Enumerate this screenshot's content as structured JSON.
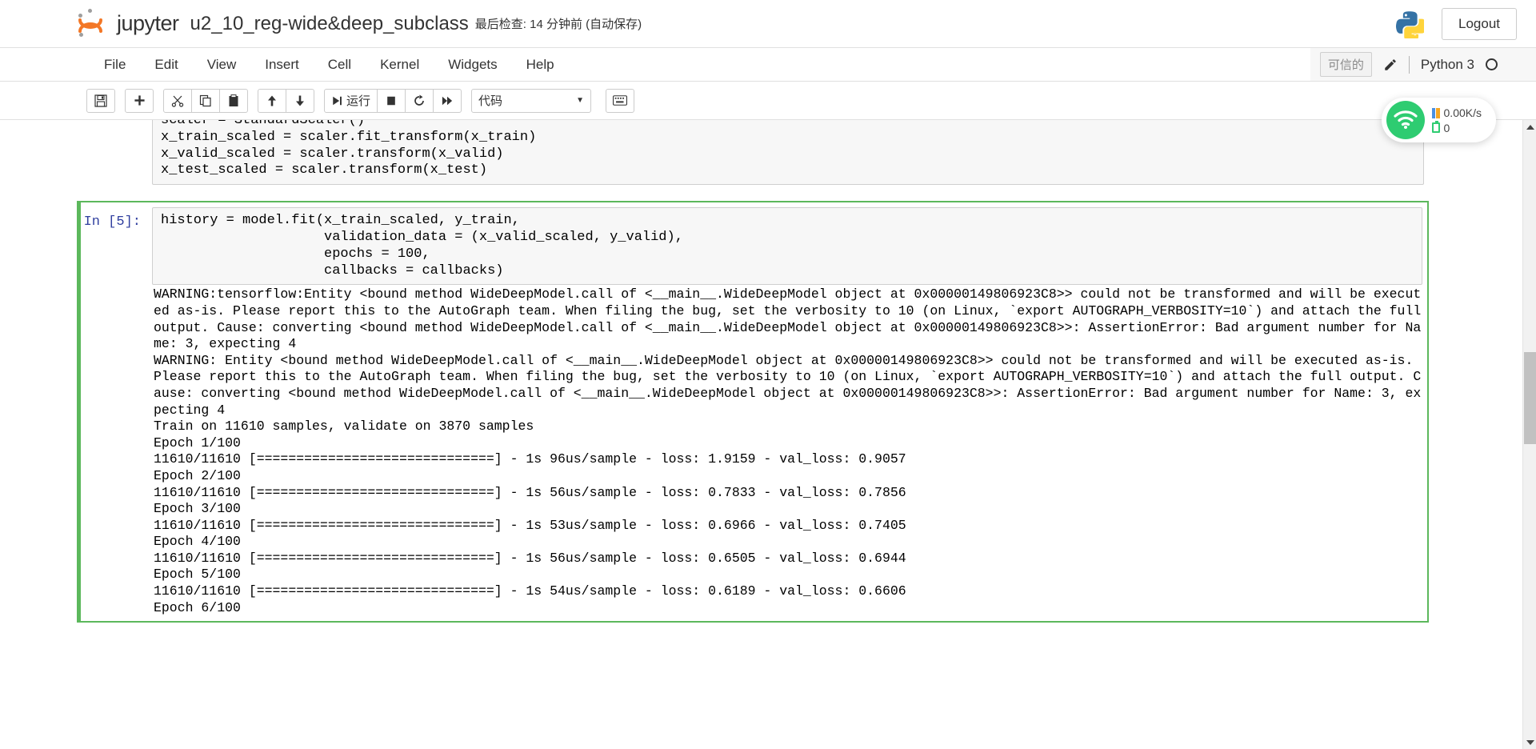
{
  "header": {
    "brand": "jupyter",
    "notebook_name": "u2_10_reg-wide&deep_subclass",
    "checkpoint": "最后检查: 14 分钟前  (自动保存)",
    "logout_label": "Logout",
    "python_logo_icon": "python-logo-icon"
  },
  "menubar": {
    "items": [
      {
        "label": "File"
      },
      {
        "label": "Edit"
      },
      {
        "label": "View"
      },
      {
        "label": "Insert"
      },
      {
        "label": "Cell"
      },
      {
        "label": "Kernel"
      },
      {
        "label": "Widgets"
      },
      {
        "label": "Help"
      }
    ],
    "trusted_label": "可信的",
    "edit_icon": "pencil-icon",
    "kernel_name": "Python 3",
    "kernel_status_icon": "kernel-idle-circle-icon"
  },
  "toolbar": {
    "groups": [
      {
        "buttons": [
          {
            "name": "save-button",
            "icon": "floppy-disk-icon",
            "glyph": "💾"
          }
        ]
      },
      {
        "buttons": [
          {
            "name": "insert-cell-below-button",
            "icon": "plus-icon",
            "glyph": "+"
          }
        ]
      },
      {
        "buttons": [
          {
            "name": "cut-cell-button",
            "icon": "scissors-icon",
            "glyph": "✂"
          },
          {
            "name": "copy-cell-button",
            "icon": "copy-icon",
            "glyph": "⧉"
          },
          {
            "name": "paste-cell-button",
            "icon": "paste-icon",
            "glyph": "📋"
          }
        ]
      },
      {
        "buttons": [
          {
            "name": "move-cell-up-button",
            "icon": "arrow-up-icon",
            "glyph": "↑"
          },
          {
            "name": "move-cell-down-button",
            "icon": "arrow-down-icon",
            "glyph": "↓"
          }
        ]
      },
      {
        "buttons": [
          {
            "name": "run-cell-button",
            "icon": "run-icon",
            "glyph": "⏭",
            "label": "运行"
          },
          {
            "name": "interrupt-kernel-button",
            "icon": "stop-square-icon",
            "glyph": "■"
          },
          {
            "name": "restart-kernel-button",
            "icon": "restart-icon",
            "glyph": "↻"
          },
          {
            "name": "restart-and-run-all-button",
            "icon": "fast-forward-icon",
            "glyph": "»"
          }
        ]
      }
    ],
    "cell_type_value": "代码",
    "cell_type_caret": "▼",
    "command_palette_icon": "keyboard-icon",
    "command_palette_glyph": "⌨"
  },
  "notebook": {
    "cells": [
      {
        "name": "code-cell-scaler",
        "prompt": "",
        "selected": false,
        "code_lines": [
          "scaler = StandardScaler()",
          "x_train_scaled = scaler.fit_transform(x_train)",
          "x_valid_scaled = scaler.transform(x_valid)",
          "x_test_scaled = scaler.transform(x_test)"
        ]
      },
      {
        "name": "code-cell-model-fit",
        "prompt": "In [5]:",
        "selected": true,
        "code_lines": [
          "history = model.fit(x_train_scaled, y_train,",
          "                    validation_data = (x_valid_scaled, y_valid),",
          "                    epochs = 100,",
          "                    callbacks = callbacks)"
        ]
      }
    ],
    "output": "WARNING:tensorflow:Entity <bound method WideDeepModel.call of <__main__.WideDeepModel object at 0x00000149806923C8>> could not be transformed and will be executed as-is. Please report this to the AutoGraph team. When filing the bug, set the verbosity to 10 (on Linux, `export AUTOGRAPH_VERBOSITY=10`) and attach the full output. Cause: converting <bound method WideDeepModel.call of <__main__.WideDeepModel object at 0x00000149806923C8>>: AssertionError: Bad argument number for Name: 3, expecting 4\nWARNING: Entity <bound method WideDeepModel.call of <__main__.WideDeepModel object at 0x00000149806923C8>> could not be transformed and will be executed as-is. Please report this to the AutoGraph team. When filing the bug, set the verbosity to 10 (on Linux, `export AUTOGRAPH_VERBOSITY=10`) and attach the full output. Cause: converting <bound method WideDeepModel.call of <__main__.WideDeepModel object at 0x00000149806923C8>>: AssertionError: Bad argument number for Name: 3, expecting 4\nTrain on 11610 samples, validate on 3870 samples\nEpoch 1/100\n11610/11610 [==============================] - 1s 96us/sample - loss: 1.9159 - val_loss: 0.9057\nEpoch 2/100\n11610/11610 [==============================] - 1s 56us/sample - loss: 0.7833 - val_loss: 0.7856\nEpoch 3/100\n11610/11610 [==============================] - 1s 53us/sample - loss: 0.6966 - val_loss: 0.7405\nEpoch 4/100\n11610/11610 [==============================] - 1s 56us/sample - loss: 0.6505 - val_loss: 0.6944\nEpoch 5/100\n11610/11610 [==============================] - 1s 54us/sample - loss: 0.6189 - val_loss: 0.6606\nEpoch 6/100"
  },
  "net_widget": {
    "wifi_icon": "wifi-icon",
    "speed": "0.00K/s",
    "count": "0",
    "upload_icon": "upload-arrow-icon",
    "download_icon": "download-arrow-icon",
    "battery_icon": "battery-icon"
  },
  "scrollbar": {
    "up_arrow_icon": "scroll-up-arrow-icon",
    "down_arrow_icon": "scroll-down-arrow-icon"
  },
  "colors": {
    "selected_cell_green": "#5cb85c",
    "prompt_blue": "#303f9f",
    "accent_orange": "#f37726",
    "net_green": "#2ecc71"
  }
}
